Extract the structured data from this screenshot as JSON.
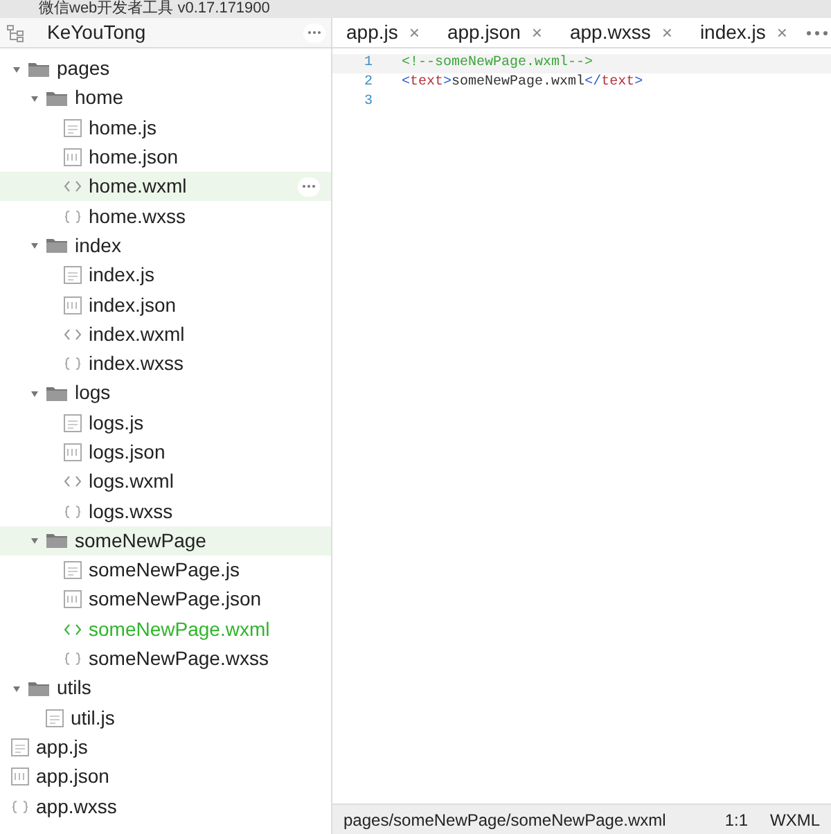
{
  "window": {
    "title": "微信web开发者工具 v0.17.171900"
  },
  "sidebar": {
    "project": "KeYouTong",
    "tree": [
      {
        "label": "pages",
        "kind": "folder",
        "expanded": true,
        "selected": false,
        "children": [
          {
            "label": "home",
            "kind": "folder",
            "expanded": true,
            "selected": false,
            "children": [
              {
                "label": "home.js",
                "kind": "js",
                "selected": false
              },
              {
                "label": "home.json",
                "kind": "json",
                "selected": false
              },
              {
                "label": "home.wxml",
                "kind": "wxml",
                "selected": true,
                "show_more": true
              },
              {
                "label": "home.wxss",
                "kind": "wxss",
                "selected": false
              }
            ]
          },
          {
            "label": "index",
            "kind": "folder",
            "expanded": true,
            "selected": false,
            "children": [
              {
                "label": "index.js",
                "kind": "js",
                "selected": false
              },
              {
                "label": "index.json",
                "kind": "json",
                "selected": false
              },
              {
                "label": "index.wxml",
                "kind": "wxml",
                "selected": false
              },
              {
                "label": "index.wxss",
                "kind": "wxss",
                "selected": false
              }
            ]
          },
          {
            "label": "logs",
            "kind": "folder",
            "expanded": true,
            "selected": false,
            "children": [
              {
                "label": "logs.js",
                "kind": "js",
                "selected": false
              },
              {
                "label": "logs.json",
                "kind": "json",
                "selected": false
              },
              {
                "label": "logs.wxml",
                "kind": "wxml",
                "selected": false
              },
              {
                "label": "logs.wxss",
                "kind": "wxss",
                "selected": false
              }
            ]
          },
          {
            "label": "someNewPage",
            "kind": "folder",
            "expanded": true,
            "selected": true,
            "children": [
              {
                "label": "someNewPage.js",
                "kind": "js",
                "selected": false
              },
              {
                "label": "someNewPage.json",
                "kind": "json",
                "selected": false
              },
              {
                "label": "someNewPage.wxml",
                "kind": "wxml",
                "selected": false,
                "open": true
              },
              {
                "label": "someNewPage.wxss",
                "kind": "wxss",
                "selected": false
              }
            ]
          }
        ]
      },
      {
        "label": "utils",
        "kind": "folder",
        "expanded": true,
        "selected": false,
        "children": [
          {
            "label": "util.js",
            "kind": "js",
            "selected": false
          }
        ]
      },
      {
        "label": "app.js",
        "kind": "js",
        "selected": false
      },
      {
        "label": "app.json",
        "kind": "json",
        "selected": false
      },
      {
        "label": "app.wxss",
        "kind": "wxss",
        "selected": false
      }
    ]
  },
  "tabs": [
    {
      "label": "app.js",
      "close": "×"
    },
    {
      "label": "app.json",
      "close": "×"
    },
    {
      "label": "app.wxss",
      "close": "×"
    },
    {
      "label": "index.js",
      "close": "×"
    }
  ],
  "editor": {
    "lines": [
      {
        "number": "1",
        "current": true,
        "segments": [
          {
            "kind": "comment",
            "text": "<!--someNewPage.wxml-->"
          }
        ]
      },
      {
        "number": "2",
        "current": false,
        "segments": [
          {
            "kind": "punct",
            "text": "<"
          },
          {
            "kind": "tag",
            "text": "text"
          },
          {
            "kind": "punct",
            "text": ">"
          },
          {
            "kind": "plain",
            "text": "someNewPage.wxml"
          },
          {
            "kind": "punct",
            "text": "</"
          },
          {
            "kind": "tag",
            "text": "text"
          },
          {
            "kind": "punct",
            "text": ">"
          }
        ]
      },
      {
        "number": "3",
        "current": false
      }
    ]
  },
  "status_bar": {
    "path": "pages/someNewPage/someNewPage.wxml",
    "position": "1:1",
    "language": "WXML"
  }
}
